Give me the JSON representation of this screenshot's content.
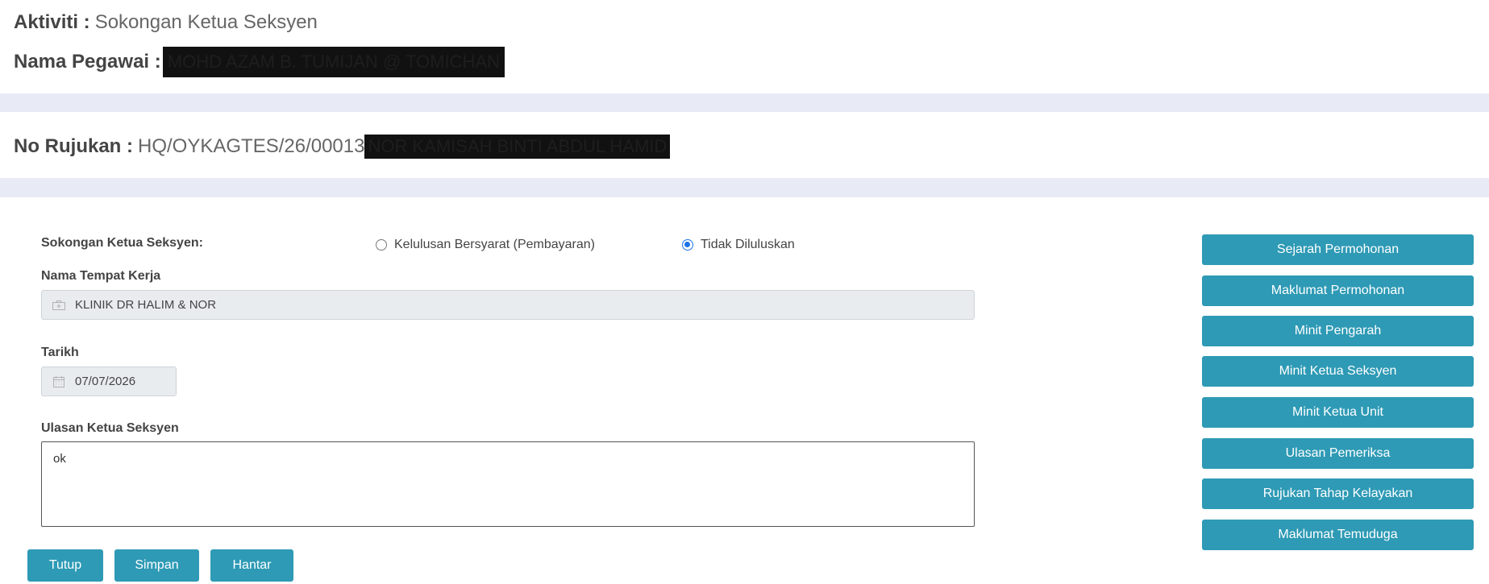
{
  "header": {
    "aktiviti_label": "Aktiviti :",
    "aktiviti_value": "Sokongan Ketua Seksyen",
    "pegawai_label": "Nama Pegawai :",
    "pegawai_value": "MOHD AZAM B. TUMIJAN @ TOMICHAN"
  },
  "reference": {
    "label": "No Rujukan :",
    "value": "HQ/OYKAGTES/26/00013",
    "name_redacted": "NOR KAMISAH BINTI ABDUL HAMID"
  },
  "form": {
    "sokongan_label": "Sokongan Ketua Seksyen:",
    "radio_options": [
      {
        "label": "Kelulusan Bersyarat (Pembayaran)",
        "checked": false
      },
      {
        "label": "Tidak Diluluskan",
        "checked": true
      }
    ],
    "tempat_label": "Nama Tempat Kerja",
    "tempat_value": "KLINIK DR HALIM & NOR",
    "tarikh_label": "Tarikh",
    "tarikh_value": "07/07/2026",
    "ulasan_label": "Ulasan Ketua Seksyen",
    "ulasan_value": "ok"
  },
  "side_buttons": [
    "Sejarah Permohonan",
    "Maklumat Permohonan",
    "Minit Pengarah",
    "Minit Ketua Seksyen",
    "Minit Ketua Unit",
    "Ulasan Pemeriksa",
    "Rujukan Tahap Kelayakan",
    "Maklumat Temuduga"
  ],
  "actions": {
    "tutup": "Tutup",
    "simpan": "Simpan",
    "hantar": "Hantar"
  },
  "icons": {
    "workplace": "medical-kit-icon",
    "date": "calendar-icon"
  },
  "colors": {
    "button": "#2e9ab5",
    "radio_checked": "#1a73e8",
    "page_band": "#e8ebf6"
  }
}
